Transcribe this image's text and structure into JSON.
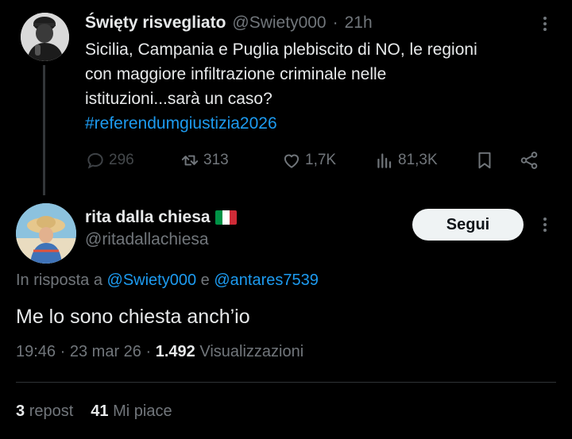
{
  "parent_tweet": {
    "display_name": "Święty risvegliato",
    "handle": "@Swiety000",
    "separator": "·",
    "time": "21h",
    "text_lines": [
      "Sicilia, Campania e Puglia plebiscito di NO, le regioni",
      "con maggiore infiltrazione criminale nelle",
      "istituzioni...sarà un caso?"
    ],
    "hashtag": "#referendumgiustizia2026",
    "actions": {
      "replies": "296",
      "reposts": "313",
      "likes": "1,7K",
      "views": "81,3K"
    }
  },
  "reply_tweet": {
    "display_name": "rita dalla chiesa",
    "flag_colors": [
      "#009246",
      "#ffffff",
      "#ce2b37"
    ],
    "handle": "@ritadallachiesa",
    "follow_label": "Segui",
    "in_reply_prefix": "In risposta a",
    "mention_1": "@Swiety000",
    "in_reply_conjunction": "e",
    "mention_2": "@antares7539",
    "text": "Me lo sono chiesta anch’io",
    "time": "19:46",
    "date": "23 mar 26",
    "separator": "·",
    "views_count": "1.492",
    "views_label": "Visualizzazioni",
    "repost_count": "3",
    "repost_label": "repost",
    "likes_count": "41",
    "likes_label": "Mi piace"
  },
  "colors": {
    "background": "#000000",
    "text": "#e7e9ea",
    "secondary": "#71767b",
    "accent": "#1d9bf0",
    "follow_button_bg": "#eff3f4"
  }
}
